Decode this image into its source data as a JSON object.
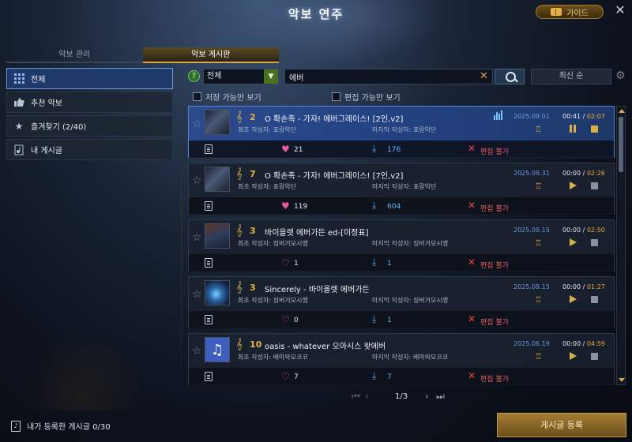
{
  "window": {
    "title": "악보 연주",
    "guide_label": "가이드",
    "close_glyph": "✕"
  },
  "main_tabs": [
    {
      "label": "악보 관리"
    },
    {
      "label": "악보 게시판"
    }
  ],
  "sidebar": {
    "items": [
      {
        "label": "전체",
        "icon": "grid-icon"
      },
      {
        "label": "추천 악보",
        "icon": "thumbs-up-icon"
      },
      {
        "label": "즐겨찾기 (2/40)",
        "icon": "star-icon"
      },
      {
        "label": "내 게시글",
        "icon": "document-icon"
      }
    ]
  },
  "filter": {
    "category_value": "전체",
    "search_value": "에버",
    "sort_label": "최신 순",
    "save_only_label": "저장 가능만 보기",
    "edit_only_label": "편집 가능만 보기"
  },
  "posts": [
    {
      "level": "2",
      "title": "O 확손족 - 가자! 에버그레이스! [2인,v2]",
      "creator": "최초 작성자: 표랑악단",
      "last_editor": "마지막 작성자: 표랑악단",
      "date": "2025.09.01",
      "elapsed": "00:41",
      "total": "02:07",
      "likes": "21",
      "downloads": "176",
      "edit_status": "편집 불가",
      "liked": true,
      "playing": true
    },
    {
      "level": "7",
      "title": "O 확손족 - 가자! 에버그레이스! [7인,v2]",
      "creator": "최초 작성자: 표랑악단",
      "last_editor": "마지막 작성자: 표랑악단",
      "date": "2025.08.31",
      "elapsed": "00:00",
      "total": "02:26",
      "likes": "119",
      "downloads": "604",
      "edit_status": "편집 불가",
      "liked": true,
      "playing": false
    },
    {
      "level": "3",
      "title": "바이올렛 에버가든 ed-[이정표]",
      "creator": "최초 작성자: 징버거모시깽",
      "last_editor": "마지막 작성자: 징버거모시깽",
      "date": "2025.08.15",
      "elapsed": "00:00",
      "total": "02:50",
      "likes": "1",
      "downloads": "1",
      "edit_status": "편집 불가",
      "liked": false,
      "playing": false
    },
    {
      "level": "3",
      "title": "Sincerely - 바이올렛 에버가든",
      "creator": "최초 작성자: 징버거모시깽",
      "last_editor": "마지막 작성자: 징버거모시깽",
      "date": "2025.08.15",
      "elapsed": "00:00",
      "total": "01:27",
      "likes": "0",
      "downloads": "1",
      "edit_status": "편집 불가",
      "liked": false,
      "playing": false
    },
    {
      "level": "10",
      "title": "oasis - whatever 오아시스 왓에버",
      "creator": "최초 작성자: 베마와모코코",
      "last_editor": "마지막 작성자: 베마와모코코",
      "date": "2025.06.19",
      "elapsed": "00:00",
      "total": "04:59",
      "likes": "7",
      "downloads": "7",
      "edit_status": "편집 불가",
      "liked": false,
      "playing": false
    }
  ],
  "pagination": {
    "current": "1/3"
  },
  "footer": {
    "my_posts_label": "내가 등록한 게시글 0/30",
    "register_label": "게시글 등록"
  },
  "colors": {
    "accent_gold": "#d8a548",
    "playing_row": "#22407e",
    "like_pink": "#e85b9c",
    "download_blue": "#55a9ea",
    "no_edit_red": "#e64040"
  }
}
